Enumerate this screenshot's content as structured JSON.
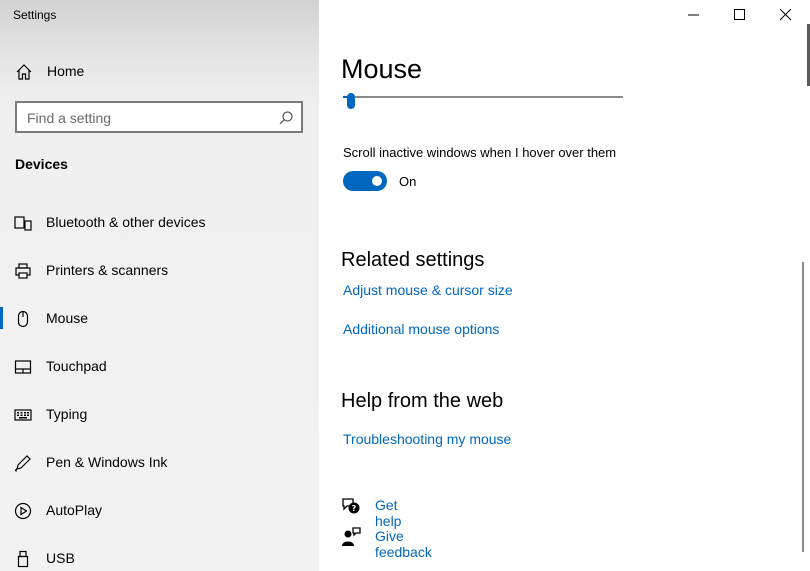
{
  "window": {
    "title": "Settings"
  },
  "sidebar": {
    "home_label": "Home",
    "search_placeholder": "Find a setting",
    "section_title": "Devices",
    "items": [
      {
        "label": "Bluetooth & other devices",
        "icon": "bluetooth-devices-icon"
      },
      {
        "label": "Printers & scanners",
        "icon": "printer-icon"
      },
      {
        "label": "Mouse",
        "icon": "mouse-icon",
        "selected": true
      },
      {
        "label": "Touchpad",
        "icon": "touchpad-icon"
      },
      {
        "label": "Typing",
        "icon": "keyboard-icon"
      },
      {
        "label": "Pen & Windows Ink",
        "icon": "pen-icon"
      },
      {
        "label": "AutoPlay",
        "icon": "autoplay-icon"
      },
      {
        "label": "USB",
        "icon": "usb-icon"
      }
    ]
  },
  "main": {
    "title": "Mouse",
    "slider_value_percent": 3,
    "scroll_inactive": {
      "label": "Scroll inactive windows when I hover over them",
      "state": "On"
    },
    "related": {
      "title": "Related settings",
      "links": [
        "Adjust mouse & cursor size",
        "Additional mouse options"
      ]
    },
    "help": {
      "title": "Help from the web",
      "links": [
        "Troubleshooting my mouse"
      ]
    },
    "actions": {
      "get_help": "Get help",
      "give_feedback": "Give feedback"
    }
  },
  "colors": {
    "accent": "#0067c0",
    "sidebar_bg": "#f2f2f2"
  }
}
